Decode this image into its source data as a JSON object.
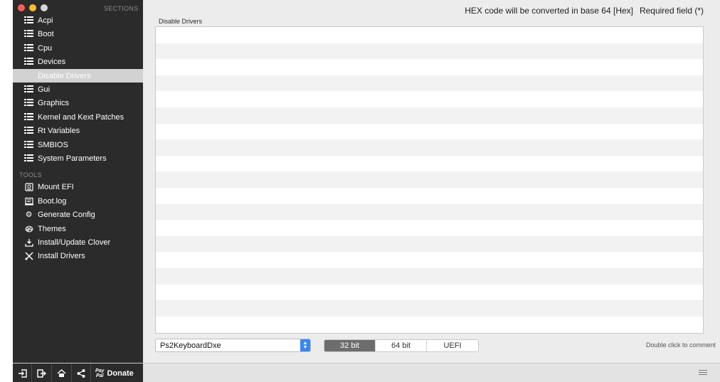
{
  "sidebar": {
    "sections_header": "SECTIONS",
    "sections": [
      {
        "label": "Acpi",
        "icon": "list-icon"
      },
      {
        "label": "Boot",
        "icon": "list-icon"
      },
      {
        "label": "Cpu",
        "icon": "list-icon"
      },
      {
        "label": "Devices",
        "icon": "list-icon"
      },
      {
        "label": "Disable Drivers",
        "icon": "list-icon",
        "selected": true
      },
      {
        "label": "Gui",
        "icon": "list-icon"
      },
      {
        "label": "Graphics",
        "icon": "list-icon"
      },
      {
        "label": "Kernel and Kext Patches",
        "icon": "list-icon"
      },
      {
        "label": "Rt Variables",
        "icon": "list-icon"
      },
      {
        "label": "SMBIOS",
        "icon": "list-icon"
      },
      {
        "label": "System Parameters",
        "icon": "list-icon"
      }
    ],
    "tools_header": "TOOLS",
    "tools": [
      {
        "label": "Mount EFI",
        "icon": "disk-icon"
      },
      {
        "label": "Boot.log",
        "icon": "log-icon"
      },
      {
        "label": "Generate Config",
        "icon": "gear-icon"
      },
      {
        "label": "Themes",
        "icon": "palette-icon"
      },
      {
        "label": "Install/Update Clover",
        "icon": "download-icon"
      },
      {
        "label": "Install Drivers",
        "icon": "tools-icon"
      }
    ]
  },
  "bottom_bar": {
    "donate_label": "Donate",
    "paypal_top": "Pay",
    "paypal_bottom": "Pal"
  },
  "main": {
    "hex_note": "HEX code will be converted in base 64 [Hex]",
    "required_note": "Required field (*)",
    "panel_title": "Disable Drivers",
    "driver_select_value": "Ps2KeyboardDxe",
    "segments": [
      {
        "label": "32 bit",
        "active": true
      },
      {
        "label": "64 bit",
        "active": false
      },
      {
        "label": "UEFI",
        "active": false
      }
    ],
    "double_click_note": "Double click to comment"
  },
  "colors": {
    "sidebar_bg": "#2b2b2b",
    "selection_bg": "#d2d2d2",
    "accent": "#3b86f5",
    "close": "#fc5f57",
    "minimize": "#fdbc2e",
    "zoom": "#d6d6d6"
  }
}
